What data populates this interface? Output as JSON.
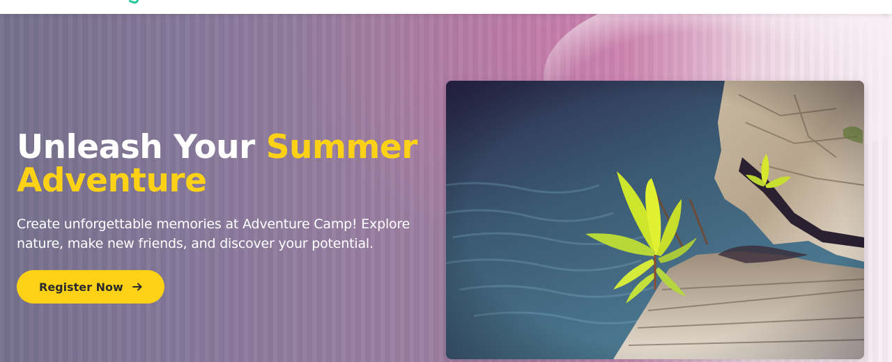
{
  "hero": {
    "title_main": "Unleash Your ",
    "title_accent_1": "Summer",
    "title_accent_2": "Adventure",
    "subtitle": "Create unforgettable memories at Adventure Camp! Explore nature, make new friends, and discover your potential.",
    "cta_label": "Register Now",
    "cta_icon": "arrow-right-icon",
    "image_subject": "sprouting-plant-on-tree-stump-by-water"
  },
  "colors": {
    "accent": "#fcd116",
    "title_white": "#ffffff",
    "button_text": "#2b2b2b",
    "nav_logo_accent": "#20c997"
  }
}
